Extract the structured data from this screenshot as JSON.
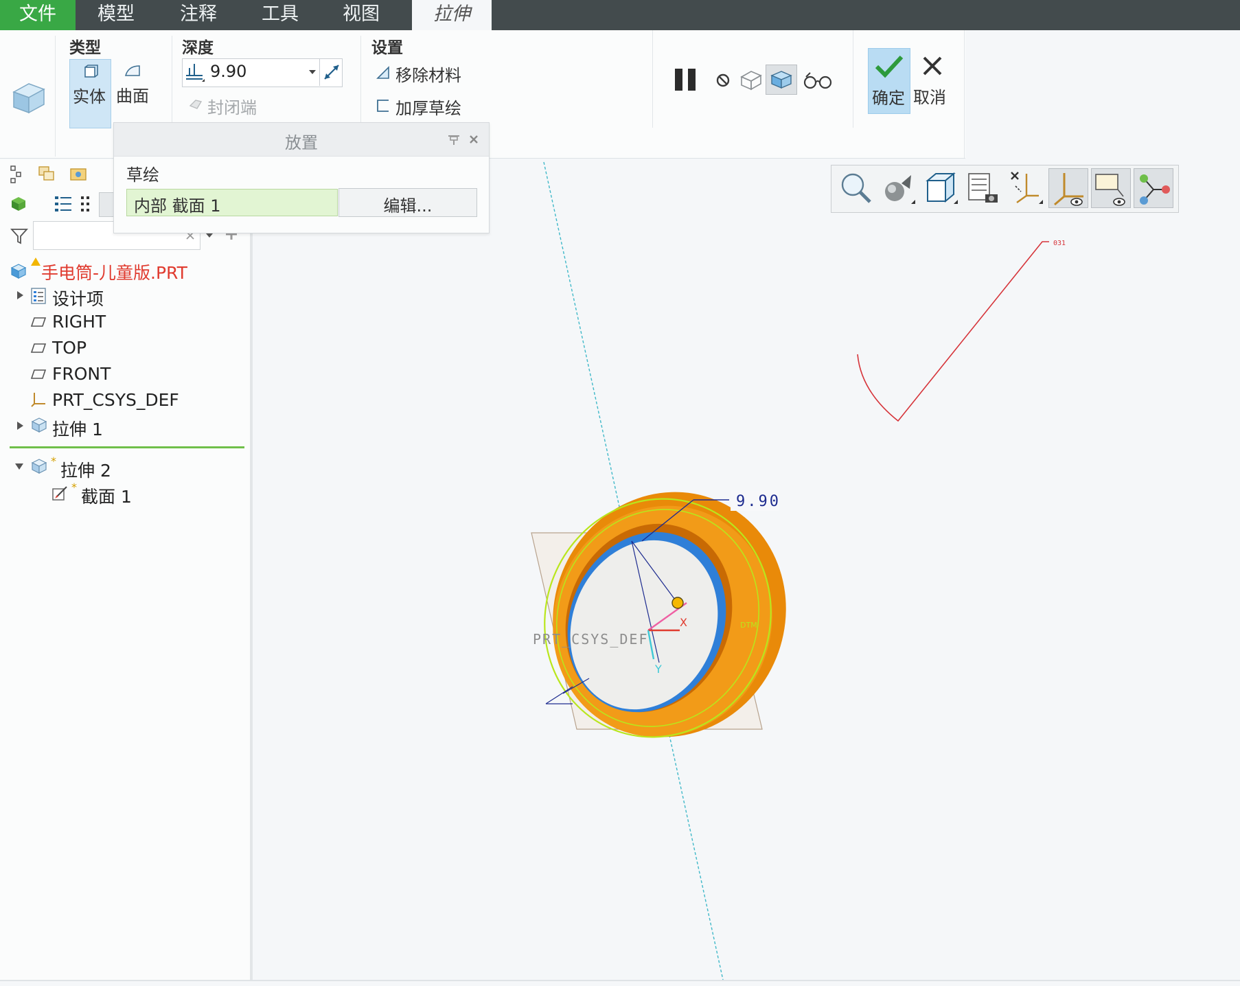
{
  "menu": {
    "file": "文件",
    "model": "模型",
    "annotate": "注释",
    "tools": "工具",
    "view": "视图",
    "extrude": "拉伸"
  },
  "ribbon": {
    "type_title": "类型",
    "solid": "实体",
    "surface": "曲面",
    "depth_title": "深度",
    "depth_value": "9.90",
    "capped_ends": "封闭端",
    "settings_title": "设置",
    "remove_material": "移除材料",
    "thicken_sketch": "加厚草绘",
    "ok": "确定",
    "cancel": "取消"
  },
  "placement": {
    "title": "放置",
    "sketch_label": "草绘",
    "sketch_value": "内部 截面 1",
    "edit_button": "编辑..."
  },
  "tree": {
    "root": "手电筒-儿童版.PRT",
    "items": [
      {
        "label": "设计项"
      },
      {
        "label": "RIGHT"
      },
      {
        "label": "TOP"
      },
      {
        "label": "FRONT"
      },
      {
        "label": "PRT_CSYS_DEF"
      },
      {
        "label": "拉伸 1"
      },
      {
        "label": "拉伸 2"
      },
      {
        "label": "截面 1"
      }
    ],
    "new_marker": "*"
  },
  "viewport": {
    "dimension": "9.90",
    "csys_label": "PRT_CSYS_DEF",
    "x_axis": "X",
    "y_axis": "Y",
    "plane_tag": "DTM",
    "small_tag": "031"
  },
  "colors": {
    "menu_bg": "#434b4d",
    "file_tab": "#39a845",
    "selected_btn": "#cfe6f6",
    "tree_root": "#e03b2f",
    "model_orange": "#e98a09",
    "preview_green": "#b9e61c",
    "inner_blue": "#2f7fd8"
  }
}
